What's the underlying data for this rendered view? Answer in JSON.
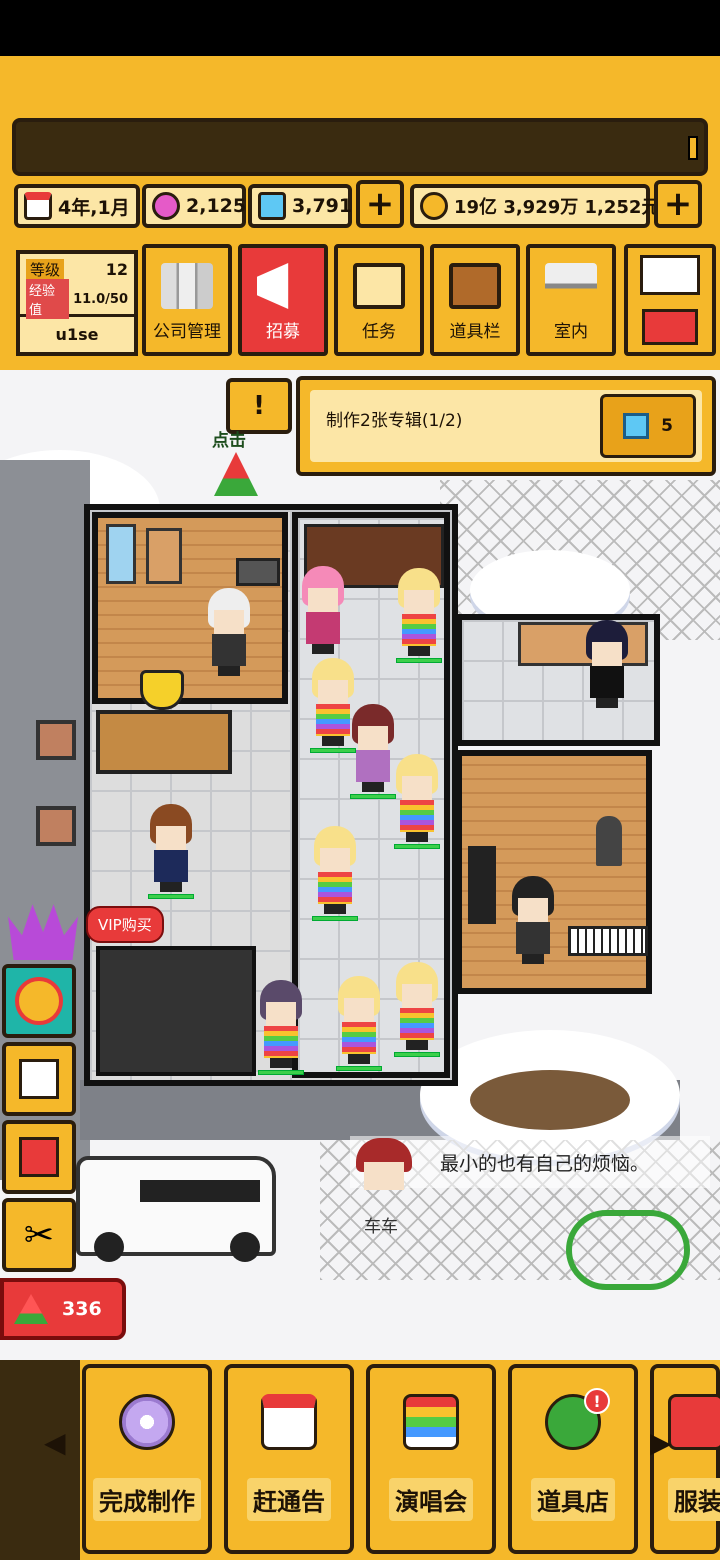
{
  "header": {
    "date": "4年,1月",
    "gems_pink": "2,125",
    "gems_blue": "3,791",
    "money": "19亿 3,929万 1,252元"
  },
  "player": {
    "level_label": "等级",
    "level": "12",
    "exp_label": "经验值",
    "exp": "11.0/50",
    "name": "u1se"
  },
  "menu": {
    "items": [
      {
        "label": "公司管理",
        "icon": "building-icon"
      },
      {
        "label": "招募",
        "icon": "megaphone-icon"
      },
      {
        "label": "任务",
        "icon": "scroll-icon"
      },
      {
        "label": "道具栏",
        "icon": "chest-icon"
      },
      {
        "label": "室内",
        "icon": "paint-roller-icon"
      }
    ]
  },
  "quest": {
    "click_hint": "点击",
    "text": "制作2张专辑(1/2)",
    "reward": "5"
  },
  "side": {
    "vip_label": "VIP购买"
  },
  "watermelon": {
    "count": "336"
  },
  "dialog": {
    "npc_name": "车车",
    "text": "最小的也有自己的烦恼。"
  },
  "bottom": {
    "buttons": [
      {
        "label": "完成制作",
        "icon": "cd-icon"
      },
      {
        "label": "赶通告",
        "icon": "calendar-icon"
      },
      {
        "label": "演唱会",
        "icon": "rainbow-stage-icon"
      },
      {
        "label": "道具店",
        "icon": "clover-icon",
        "badge": "!"
      },
      {
        "label": "服装",
        "icon": "clothes-icon"
      }
    ]
  },
  "colors": {
    "accent": "#f5b82a",
    "panel_light": "#fce6a6",
    "border_dark": "#2a1d0e",
    "red": "#e83a3a"
  }
}
